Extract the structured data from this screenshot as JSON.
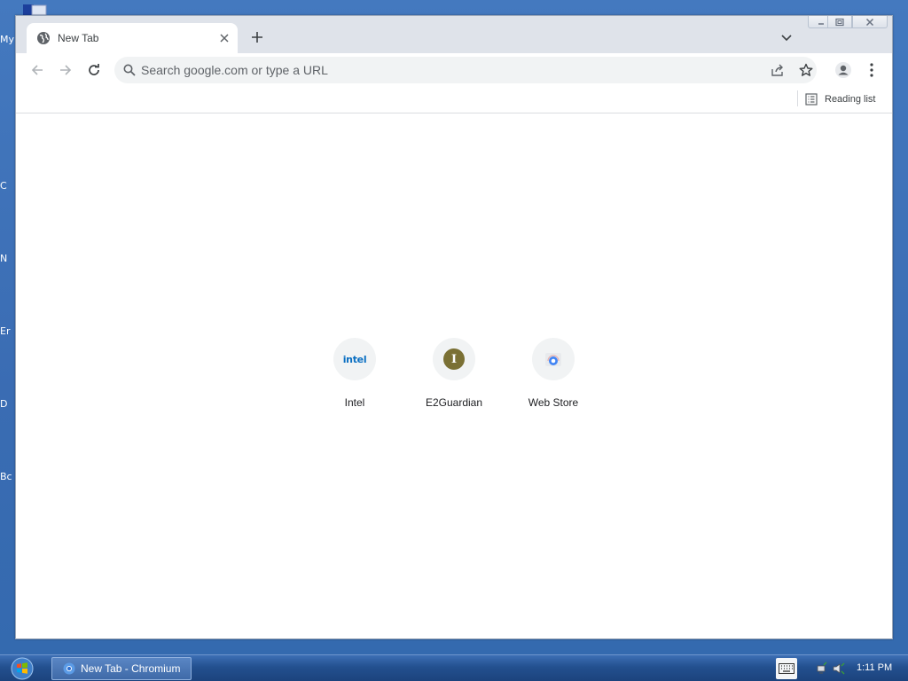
{
  "desktop": {
    "icon_labels": [
      "My",
      "C",
      "N",
      "Er",
      "D",
      "Bc"
    ]
  },
  "browser": {
    "tab": {
      "title": "New Tab",
      "favicon": "globe-icon",
      "close_icon": "close-icon"
    },
    "new_tab_icon": "plus-icon",
    "tab_search_icon": "chevron-down-icon",
    "window_controls": [
      "minimize-icon",
      "maximize-icon",
      "close-icon"
    ],
    "toolbar": {
      "back_icon": "arrow-left-icon",
      "forward_icon": "arrow-right-icon",
      "reload_icon": "reload-icon",
      "omnibox_placeholder": "Search google.com or type a URL",
      "omnibox_value": "",
      "share_icon": "share-icon",
      "bookmark_icon": "star-icon",
      "profile_icon": "person-icon",
      "menu_icon": "kebab-menu-icon"
    },
    "bookmarks_bar": {
      "reading_list": "Reading list"
    },
    "shortcuts": [
      {
        "label": "Intel",
        "icon": "intel-logo",
        "icon_text": "intel"
      },
      {
        "label": "E2Guardian",
        "icon": "letter-badge",
        "icon_text": "I"
      },
      {
        "label": "Web Store",
        "icon": "web-store-icon",
        "icon_text": ""
      }
    ]
  },
  "taskbar": {
    "start_icon": "windows-logo-icon",
    "task_item": "New Tab - Chromium",
    "tray": [
      "keyboard-icon",
      "network-icon",
      "volume-icon"
    ],
    "clock": "1:11 PM"
  },
  "colors": {
    "desktop_bg": "#3b70b8",
    "tab_strip": "#dfe3ea",
    "omnibox": "#f1f3f4",
    "intel_blue": "#0a6fc2",
    "e2_badge": "#7a7034",
    "taskbar": "#23508f"
  }
}
